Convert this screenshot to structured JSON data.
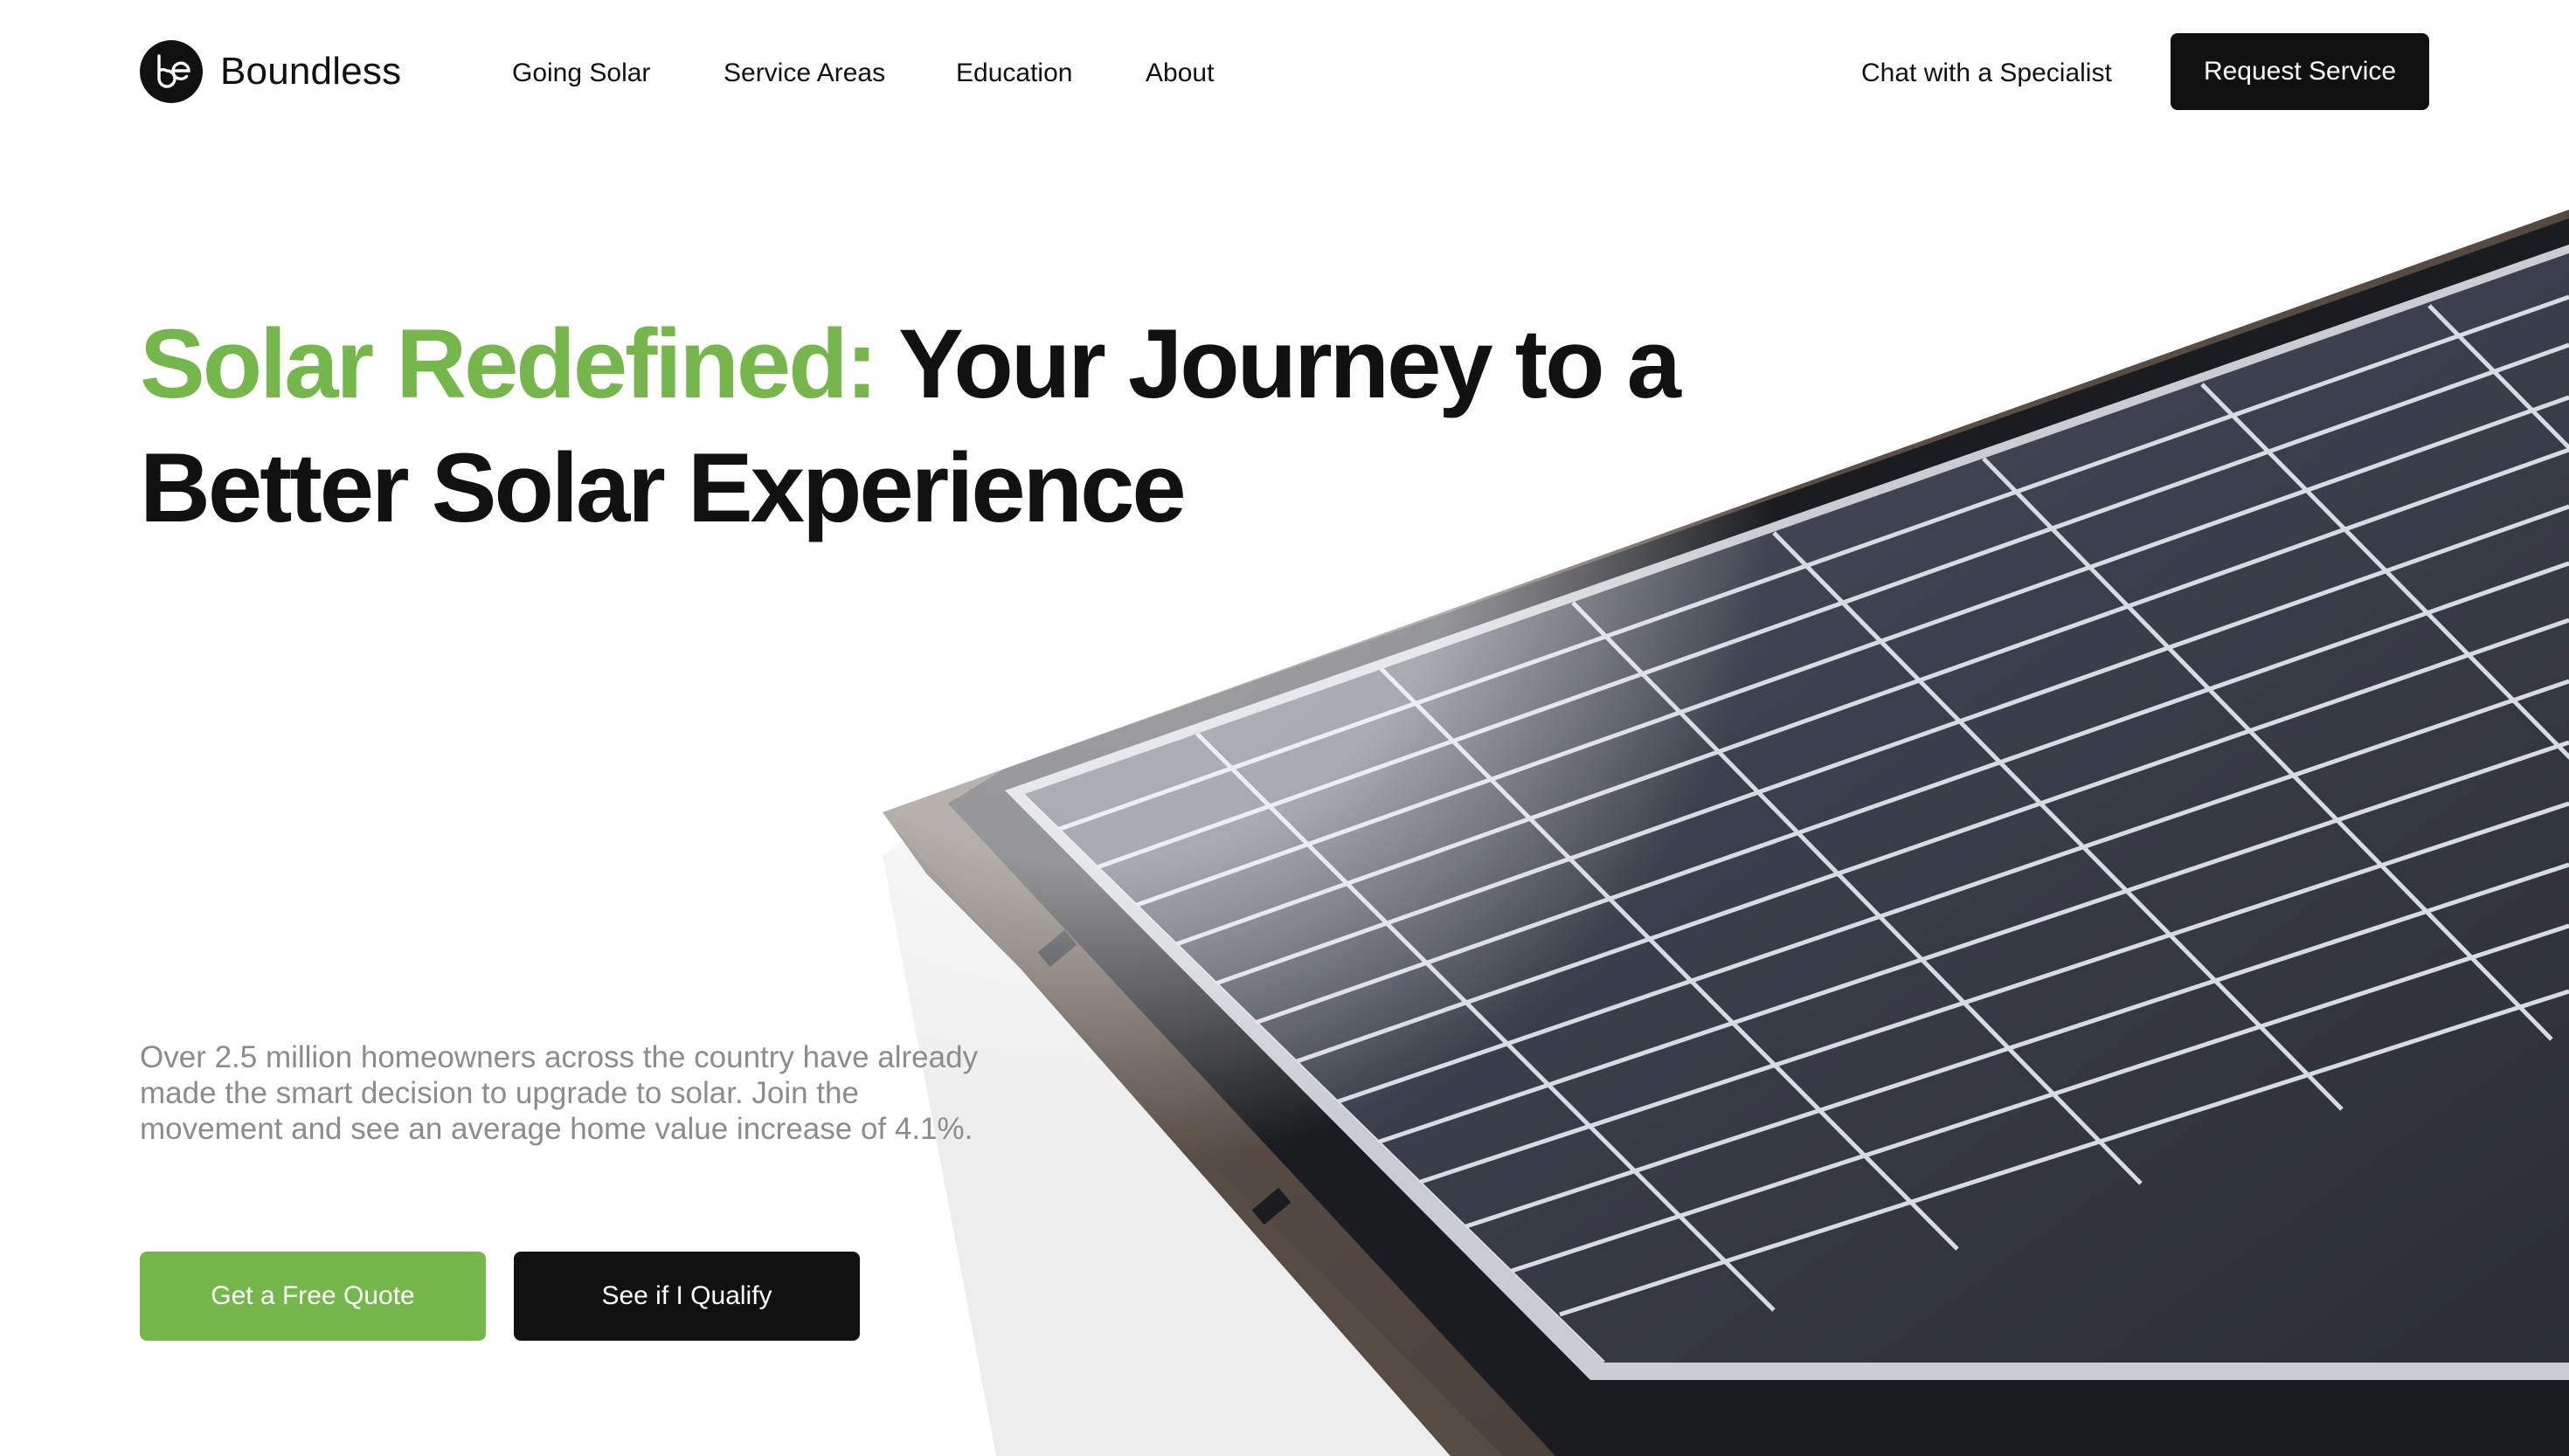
{
  "header": {
    "logo_text": "Boundless",
    "nav": [
      {
        "label": "Going Solar"
      },
      {
        "label": "Service Areas"
      },
      {
        "label": "Education"
      },
      {
        "label": "About"
      }
    ],
    "chat_label": "Chat with a Specialist",
    "request_label": "Request Service"
  },
  "hero": {
    "headline_accent": "Solar Redefined:",
    "headline_rest": "Your Journey to a Better Solar Experience",
    "subtext": "Over 2.5 million homeowners across the country have already made the smart decision to upgrade to solar. Join the movement and see an average home value increase of 4.1%.",
    "primary_cta": "Get a Free Quote",
    "secondary_cta": "See if I Qualify"
  },
  "colors": {
    "accent": "#76b74b",
    "dark": "#111111",
    "muted_text": "#8c8c8c",
    "background": "#ffffff"
  },
  "icons": {
    "logo": "boundless-logo-icon"
  }
}
